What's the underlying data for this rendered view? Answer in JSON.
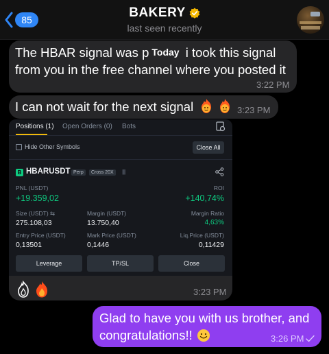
{
  "header": {
    "back_count": "85",
    "title": "BAKERY",
    "status": "last seen recently"
  },
  "messages": {
    "m1": {
      "text_before": "The HBAR signal was p",
      "inline_label": "Today",
      "text_after": " i took this signal",
      "line2": "from you in the free channel where you posted it",
      "time": "3:22 PM"
    },
    "m2": {
      "text": "I can not wait for the next signal",
      "time": "3:23 PM"
    },
    "m3": {
      "time": "3:23 PM"
    },
    "m4": {
      "line1": "Glad to have you with us brother, and",
      "line2": "congratulations!!",
      "time": "3:26 PM"
    }
  },
  "position_card": {
    "tabs": [
      "Positions (1)",
      "Open Orders (0)",
      "Bots"
    ],
    "hide_label": "Hide Other Symbols",
    "close_all": "Close All",
    "badge": "B",
    "symbol": "HBARUSDT",
    "tag_type": "Perp",
    "tag_margin": "Cross 20X",
    "bars": "||||",
    "pnl_label": "PNL (USDT)",
    "pnl_value": "+19.359,02",
    "roi_label": "ROI",
    "roi_value": "+140,74%",
    "size_label": "Size (USDT) ⇆",
    "size_value": "275.108,03",
    "margin_label": "Margin (USDT)",
    "margin_value": "13.750,40",
    "margin_ratio_label": "Margin Ratio",
    "margin_ratio_value": "4,63%",
    "entry_label": "Entry Price (USDT)",
    "entry_value": "0,13501",
    "mark_label": "Mark Price (USDT)",
    "mark_value": "0,1446",
    "liq_label": "Liq.Price (USDT)",
    "liq_value": "0,11429",
    "buttons": [
      "Leverage",
      "TP/SL",
      "Close"
    ]
  },
  "colors": {
    "incoming_bubble": "#262628",
    "outgoing_bubble": "#8f3ef0",
    "accent_blue": "#2f86f6",
    "profit_green": "#0ecb81",
    "tab_underline": "#f0b90b"
  }
}
